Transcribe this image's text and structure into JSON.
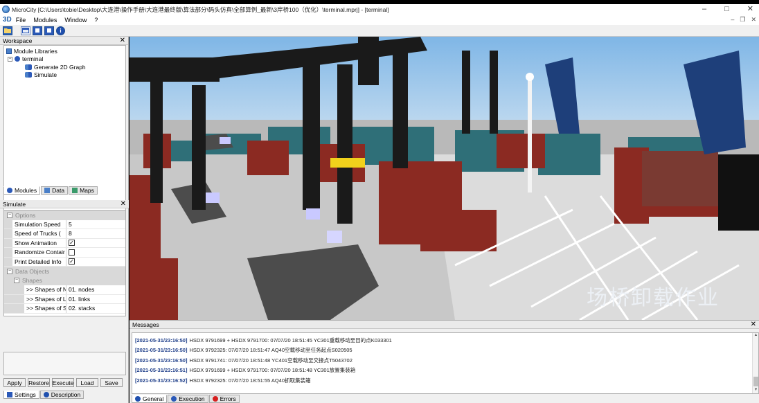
{
  "window": {
    "title": "MicroCity [C:\\Users\\tobie\\Desktop\\大连港\\操作手册\\大连港最终版\\算法部分\\码头仿真\\全部算例_最新\\3岸桥100（优化）\\terminal.mprj] - [terminal]",
    "minimize": "–",
    "maximize": "□",
    "close": "✕"
  },
  "menubar": {
    "logo": "3D",
    "items": [
      "File",
      "Modules",
      "Window",
      "?"
    ],
    "mdi_controls": [
      "–",
      "❐",
      "✕"
    ]
  },
  "toolbar": {
    "icons": [
      "open-folder-icon",
      "view-icon",
      "window-icon",
      "window2-icon",
      "info-icon"
    ]
  },
  "workspace": {
    "title": "Workspace",
    "close": "✕",
    "tree": {
      "root": "Module Libraries",
      "project": "terminal",
      "modules": [
        "Generate 2D Graph",
        "Simulate"
      ]
    },
    "tabs": [
      "Modules",
      "Data",
      "Maps"
    ]
  },
  "simulate": {
    "title": "Simulate",
    "close": "✕",
    "options_label": "Options",
    "options": [
      {
        "name": "Simulation Speed",
        "value": "5"
      },
      {
        "name": "Speed of Trucks (",
        "value": "8"
      },
      {
        "name": "Show Animation",
        "checked": true
      },
      {
        "name": "Randomize Contair",
        "checked": false
      },
      {
        "name": "Print Detailed Info",
        "checked": true
      }
    ],
    "data_objects_label": "Data Objects",
    "shapes_label": "Shapes",
    "shapes": [
      {
        "name": ">> Shapes of N",
        "value": "01. nodes"
      },
      {
        "name": ">> Shapes of L",
        "value": "01. links"
      },
      {
        "name": ">> Shapes of S",
        "value": "02. stacks"
      }
    ],
    "buttons": [
      "Apply",
      "Restore",
      "Execute",
      "Load",
      "Save"
    ],
    "tabs": [
      "Settings",
      "Description"
    ]
  },
  "viewport": {
    "caption": "场桥卸载作业"
  },
  "messages": {
    "title": "Messages",
    "close": "✕",
    "lines": [
      {
        "ts": "[2021-05-31/23:16:50]",
        "text": "HSDX 9791699 + HSDX 9791700: 07/07/20 18:51:45 YC301重载移动至目的点K033301"
      },
      {
        "ts": "[2021-05-31/23:16:50]",
        "text": "HSDX 9792325: 07/07/20 18:51:47 AQ40空载移动至任务起点S020505"
      },
      {
        "ts": "[2021-05-31/23:16:50]",
        "text": "HSDX 9791741: 07/07/20 18:51:48 YC401空载移动至交接点T5043702"
      },
      {
        "ts": "[2021-05-31/23:16:51]",
        "text": "HSDX 9791699 + HSDX 9791700: 07/07/20 18:51:48 YC301放置集装箱"
      },
      {
        "ts": "[2021-05-31/23:16:52]",
        "text": "HSDX 9792325: 07/07/20 18:51:55 AQ40抓取集装箱"
      }
    ],
    "tabs": [
      "General",
      "Execution",
      "Errors"
    ]
  }
}
